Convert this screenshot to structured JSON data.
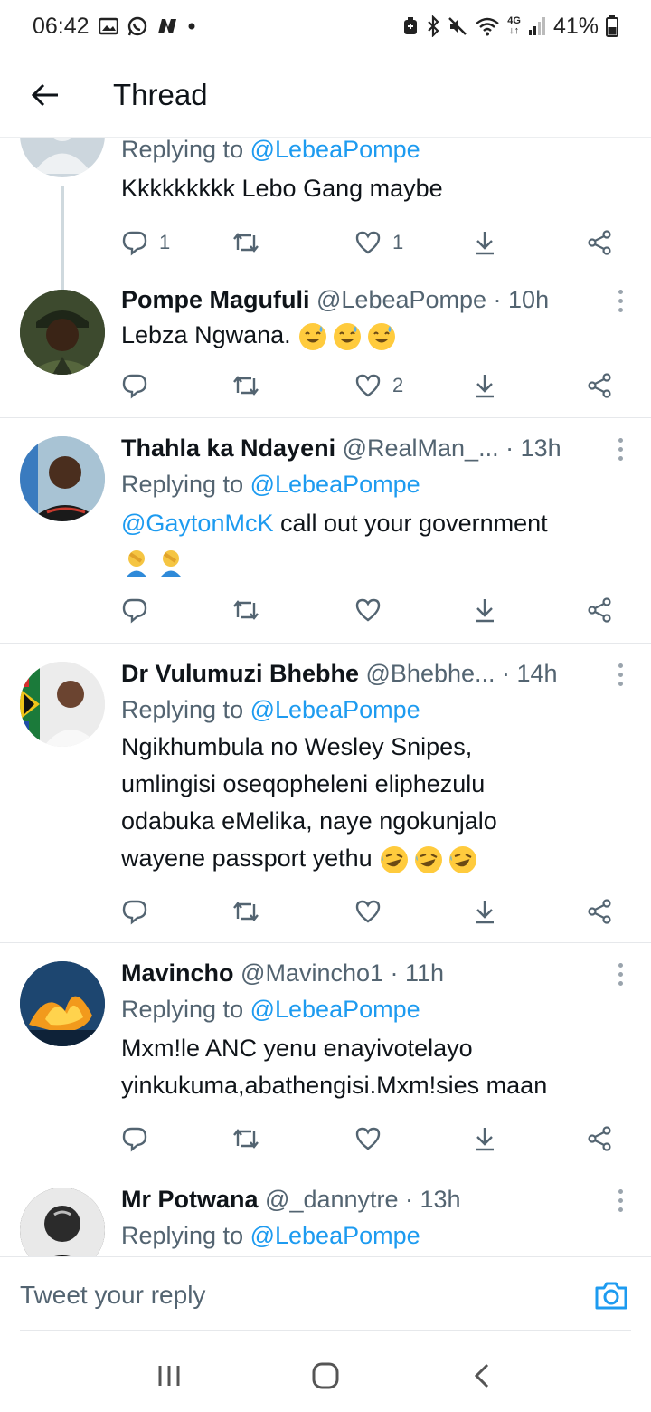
{
  "status_bar": {
    "time": "06:42",
    "network": "4G",
    "battery": "41%"
  },
  "header": {
    "title": "Thread"
  },
  "tweets": [
    {
      "replying_prefix": "Replying to ",
      "replying_handle": "@LebeaPompe",
      "text": "Kkkkkkkkk Lebo Gang maybe",
      "reply_count": "1",
      "retweet_count": "",
      "like_count": "1",
      "avatar": "default-avatar"
    },
    {
      "name": "Pompe Magufuli",
      "meta": " @LebeaPompe · 10h",
      "text": "Lebza Ngwana.",
      "emojis": [
        "sweat-smile",
        "sweat-smile",
        "sweat-smile"
      ],
      "reply_count": "",
      "retweet_count": "",
      "like_count": "2",
      "avatar": "military-portrait"
    },
    {
      "name": "Thahla ka Ndayeni",
      "meta": " @RealMan_... · 13h",
      "replying_prefix": "Replying to ",
      "replying_handle": "@LebeaPompe",
      "mention": "@GaytonMcK",
      "text": " call out your government",
      "emojis": [
        "facepalm",
        "facepalm"
      ],
      "reply_count": "",
      "retweet_count": "",
      "like_count": "",
      "avatar": "man-portrait"
    },
    {
      "name": "Dr Vulumuzi Bhebhe",
      "meta": " @Bhebhe... · 14h",
      "replying_prefix": "Replying to ",
      "replying_handle": "@LebeaPompe",
      "lines": [
        "Ngikhumbula no Wesley Snipes,",
        "umlingisi oseqopheleni eliphezulu",
        "odabuka eMelika, naye ngokunjalo",
        "wayene passport yethu"
      ],
      "emojis": [
        "rofl",
        "rofl",
        "rofl"
      ],
      "reply_count": "",
      "retweet_count": "",
      "like_count": "",
      "avatar": "flag-portrait"
    },
    {
      "name": "Mavincho",
      "meta": " @Mavincho1 · 11h",
      "replying_prefix": "Replying to ",
      "replying_handle": "@LebeaPompe",
      "lines": [
        "Mxm!le ANC yenu enayivotelayo",
        "yinkukuma,abathengisi.Mxm!sies maan"
      ],
      "reply_count": "",
      "retweet_count": "",
      "like_count": "",
      "avatar": "fire-avatar"
    },
    {
      "name": "Mr Potwana",
      "meta": " @_dannytre · 13h",
      "replying_prefix": "Replying to ",
      "replying_handle": "@LebeaPompe",
      "avatar": "bw-portrait"
    }
  ],
  "reply_bar": {
    "placeholder": "Tweet your reply"
  },
  "colors": {
    "accent": "#1d9bf0",
    "text": "#0f1419",
    "muted": "#536471"
  }
}
